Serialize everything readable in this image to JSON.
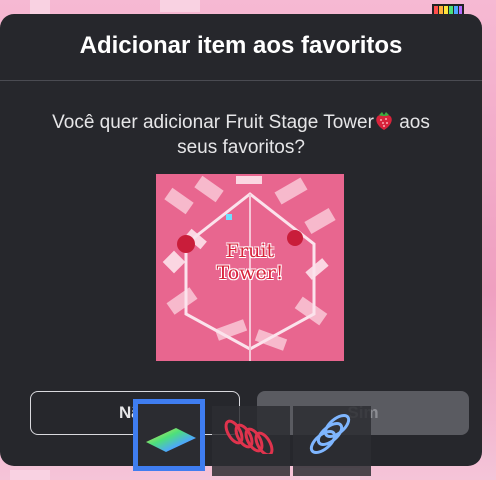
{
  "dialog": {
    "title": "Adicionar item aos favoritos",
    "message_before": "Você quer adicionar Fruit Stage Tower",
    "message_after": " aos seus favoritos?",
    "thumbnail_text_line1": "Fruit",
    "thumbnail_text_line2": "Tower!",
    "no_label": "Não",
    "yes_label": "Sim"
  },
  "icons": {
    "berry": "strawberry-icon",
    "hotbar_item_1": "rainbow-glider-icon",
    "hotbar_item_2": "red-coil-icon",
    "hotbar_item_3": "blue-coil-icon"
  },
  "colors": {
    "dialog_bg": "#26272c",
    "accent_blue": "#3f7df0",
    "pink": "#e45f8d"
  }
}
